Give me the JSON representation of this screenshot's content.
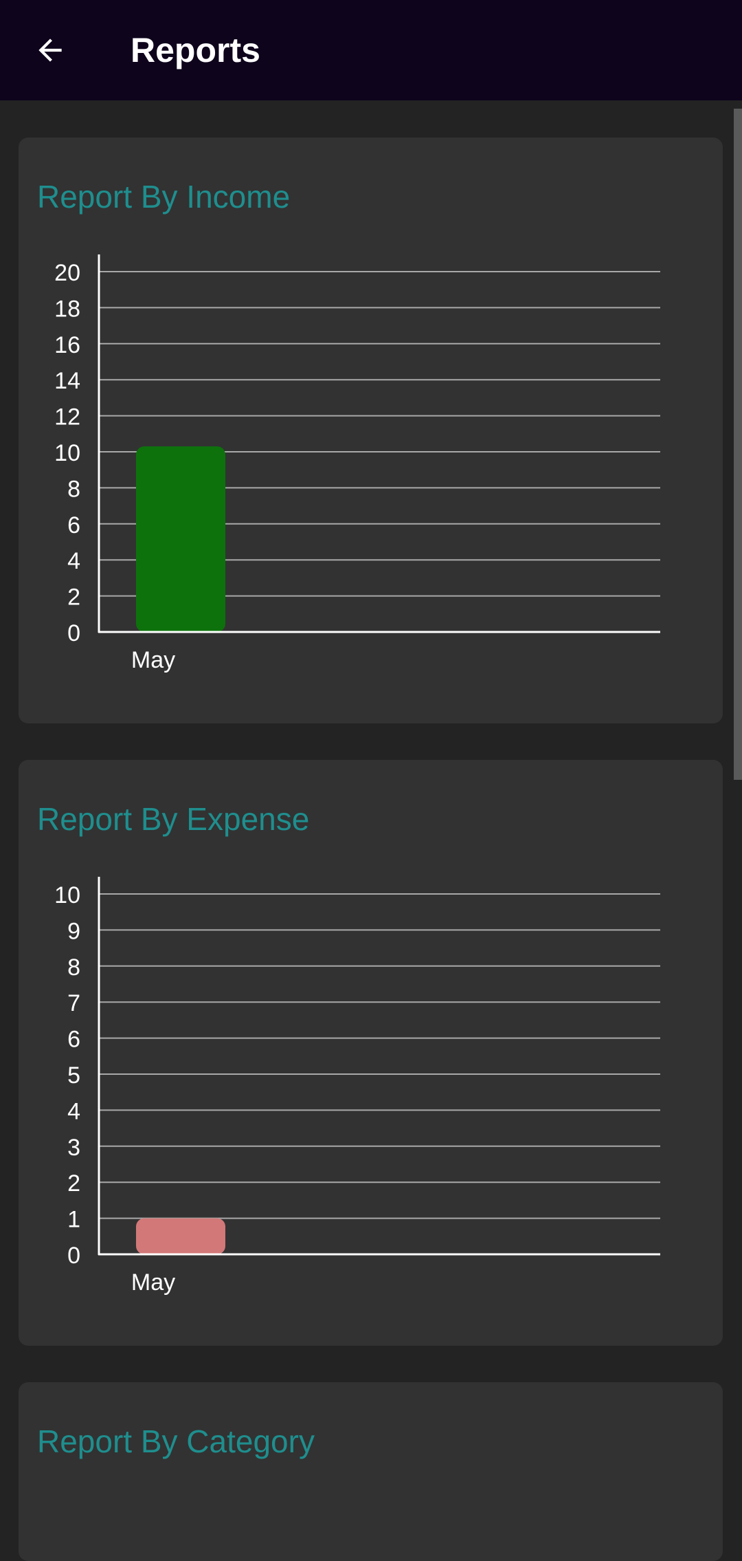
{
  "app_bar": {
    "title": "Reports",
    "back_icon": "arrow-back-icon"
  },
  "colors": {
    "app_bar_bg": "#0e041c",
    "page_bg": "#232323",
    "card_bg": "#323232",
    "title_teal": "#1f8e8e",
    "income_bar": "#0d720b",
    "expense_bar": "#d27878"
  },
  "cards": [
    {
      "title": "Report By Income",
      "chart_data": {
        "type": "bar",
        "categories": [
          "May"
        ],
        "values": [
          10.3
        ],
        "ylim": [
          0,
          20
        ],
        "yticks": [
          0,
          2,
          4,
          6,
          8,
          10,
          12,
          14,
          16,
          18,
          20
        ],
        "grid": true,
        "legend": "none"
      }
    },
    {
      "title": "Report By Expense",
      "chart_data": {
        "type": "bar",
        "categories": [
          "May"
        ],
        "values": [
          1
        ],
        "ylim": [
          0,
          10
        ],
        "yticks": [
          0,
          1,
          2,
          3,
          4,
          5,
          6,
          7,
          8,
          9,
          10
        ],
        "grid": true,
        "legend": "none"
      }
    },
    {
      "title": "Report By Category"
    }
  ]
}
